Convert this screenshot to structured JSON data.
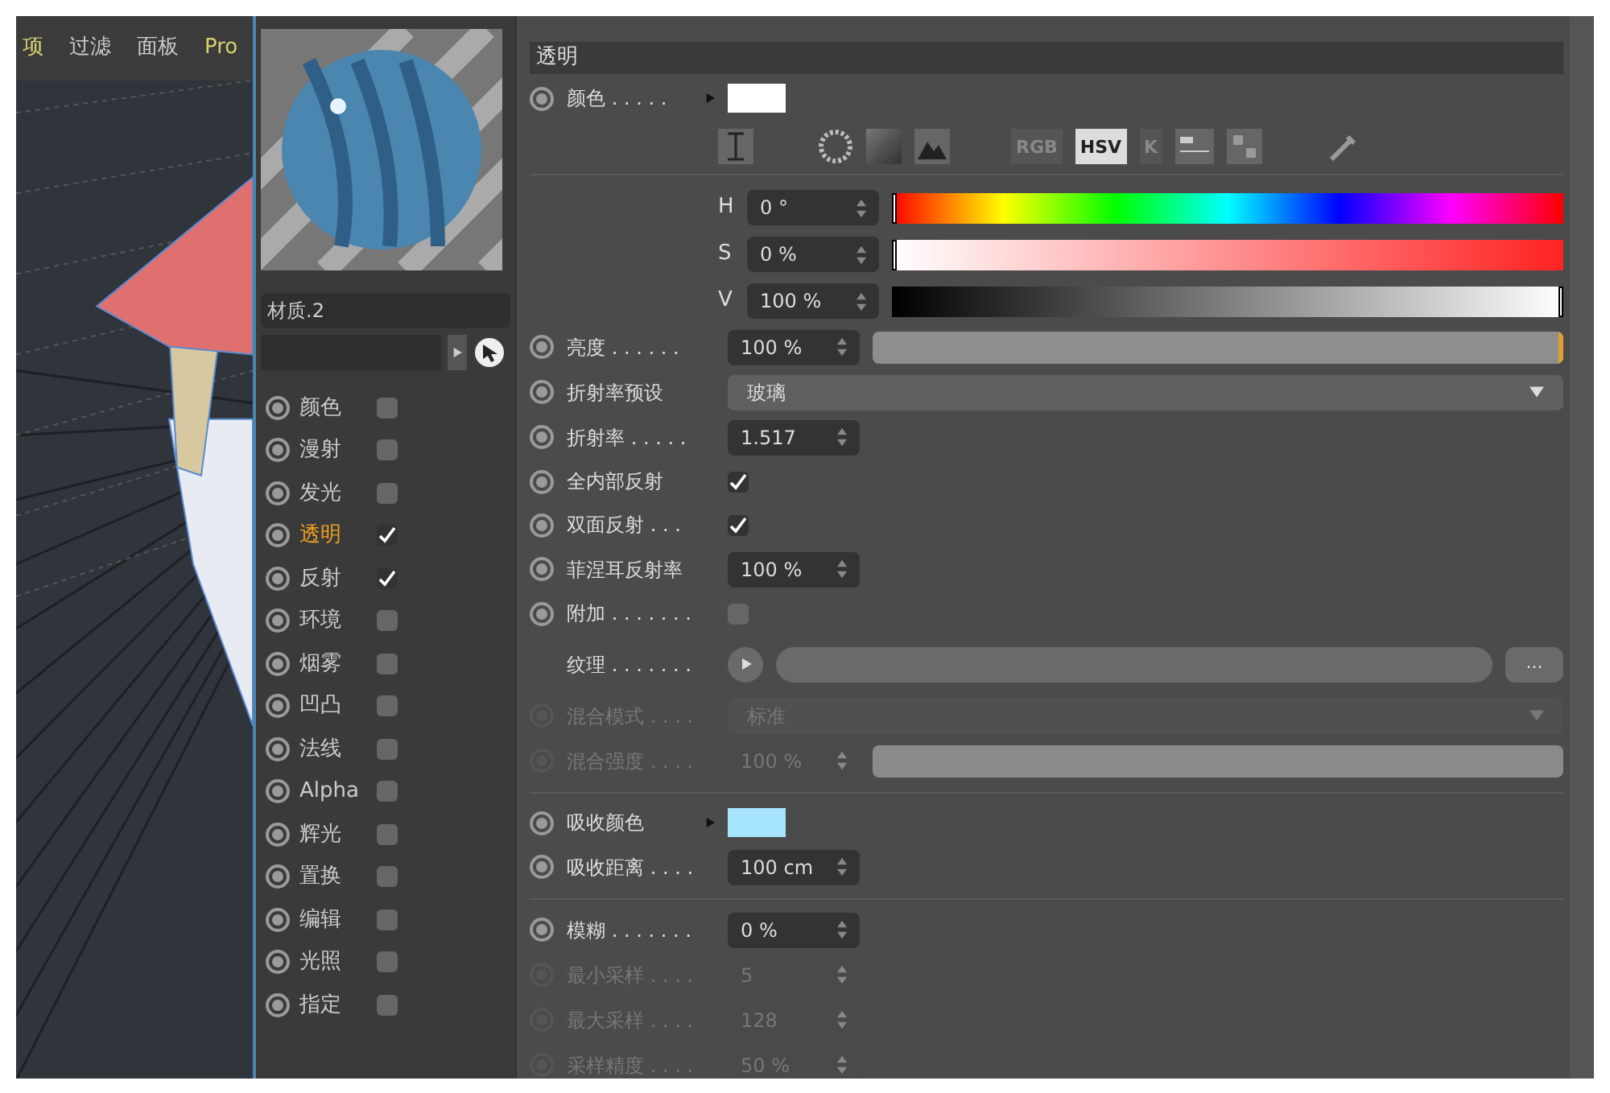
{
  "viewport": {
    "menu": [
      "项",
      "过滤",
      "面板",
      "Pro"
    ]
  },
  "material": {
    "name": "材质.2",
    "channels": [
      {
        "label": "颜色",
        "checked": false,
        "selected": false
      },
      {
        "label": "漫射",
        "checked": false,
        "selected": false
      },
      {
        "label": "发光",
        "checked": false,
        "selected": false
      },
      {
        "label": "透明",
        "checked": true,
        "selected": true
      },
      {
        "label": "反射",
        "checked": true,
        "selected": false
      },
      {
        "label": "环境",
        "checked": false,
        "selected": false
      },
      {
        "label": "烟雾",
        "checked": false,
        "selected": false
      },
      {
        "label": "凹凸",
        "checked": false,
        "selected": false
      },
      {
        "label": "法线",
        "checked": false,
        "selected": false
      },
      {
        "label": "Alpha",
        "checked": false,
        "selected": false
      },
      {
        "label": "辉光",
        "checked": false,
        "selected": false
      },
      {
        "label": "置换",
        "checked": false,
        "selected": false
      },
      {
        "label": "编辑",
        "checked": false,
        "selected": false
      },
      {
        "label": "光照",
        "checked": false,
        "selected": false
      },
      {
        "label": "指定",
        "checked": false,
        "selected": false
      }
    ]
  },
  "attributes": {
    "header": "透明",
    "rows": [
      {
        "kind": "color",
        "label": "颜色 . . . . .",
        "color": "#ffffff"
      },
      {
        "kind": "tools",
        "modes": [
          {
            "label": "RGB",
            "selected": false
          },
          {
            "label": "HSV",
            "selected": true
          },
          {
            "label": "K",
            "selected": false
          }
        ]
      },
      {
        "kind": "hue",
        "label": "H",
        "value": "0 °",
        "level": 0
      },
      {
        "kind": "saturation",
        "label": "S",
        "value": "0 %",
        "level": 0
      },
      {
        "kind": "value",
        "label": "V",
        "value": "100 %",
        "level": 1
      },
      {
        "kind": "slider",
        "label": "亮度 . . . . . .",
        "value": "100 %",
        "level": 1,
        "disabled": false
      },
      {
        "kind": "dropdown",
        "label": "折射率预设",
        "value": "玻璃",
        "disabled": false
      },
      {
        "kind": "number",
        "label": "折射率 . . . . .",
        "value": "1.517",
        "disabled": false
      },
      {
        "kind": "checkbox",
        "label": "全内部反射",
        "checked": true
      },
      {
        "kind": "checkbox",
        "label": "双面反射 . . .",
        "checked": true
      },
      {
        "kind": "number",
        "label": "菲涅耳反射率",
        "value": "100 %",
        "disabled": false
      },
      {
        "kind": "checkbox",
        "label": "附加 . . . . . . .",
        "checked": false
      },
      {
        "kind": "texture",
        "label": "纹理 . . . . . . .",
        "button": "..."
      },
      {
        "kind": "dropdown",
        "label": "混合模式 . . . .",
        "value": "标准",
        "disabled": true
      },
      {
        "kind": "slider",
        "label": "混合强度 . . . .",
        "value": "100 %",
        "level": 1,
        "disabled": true
      },
      {
        "kind": "separator"
      },
      {
        "kind": "color",
        "label": "吸收颜色",
        "color": "#a6e4fb"
      },
      {
        "kind": "number",
        "label": "吸收距离 . . . .",
        "value": "100 cm",
        "disabled": false
      },
      {
        "kind": "separator"
      },
      {
        "kind": "number",
        "label": "模糊 . . . . . . .",
        "value": "0 %",
        "disabled": false
      },
      {
        "kind": "number",
        "label": "最小采样 . . . .",
        "value": "5",
        "disabled": true
      },
      {
        "kind": "number",
        "label": "最大采样 . . . .",
        "value": "128",
        "disabled": true
      },
      {
        "kind": "number",
        "label": "采样精度 . . . .",
        "value": "50 %",
        "disabled": true
      }
    ]
  }
}
